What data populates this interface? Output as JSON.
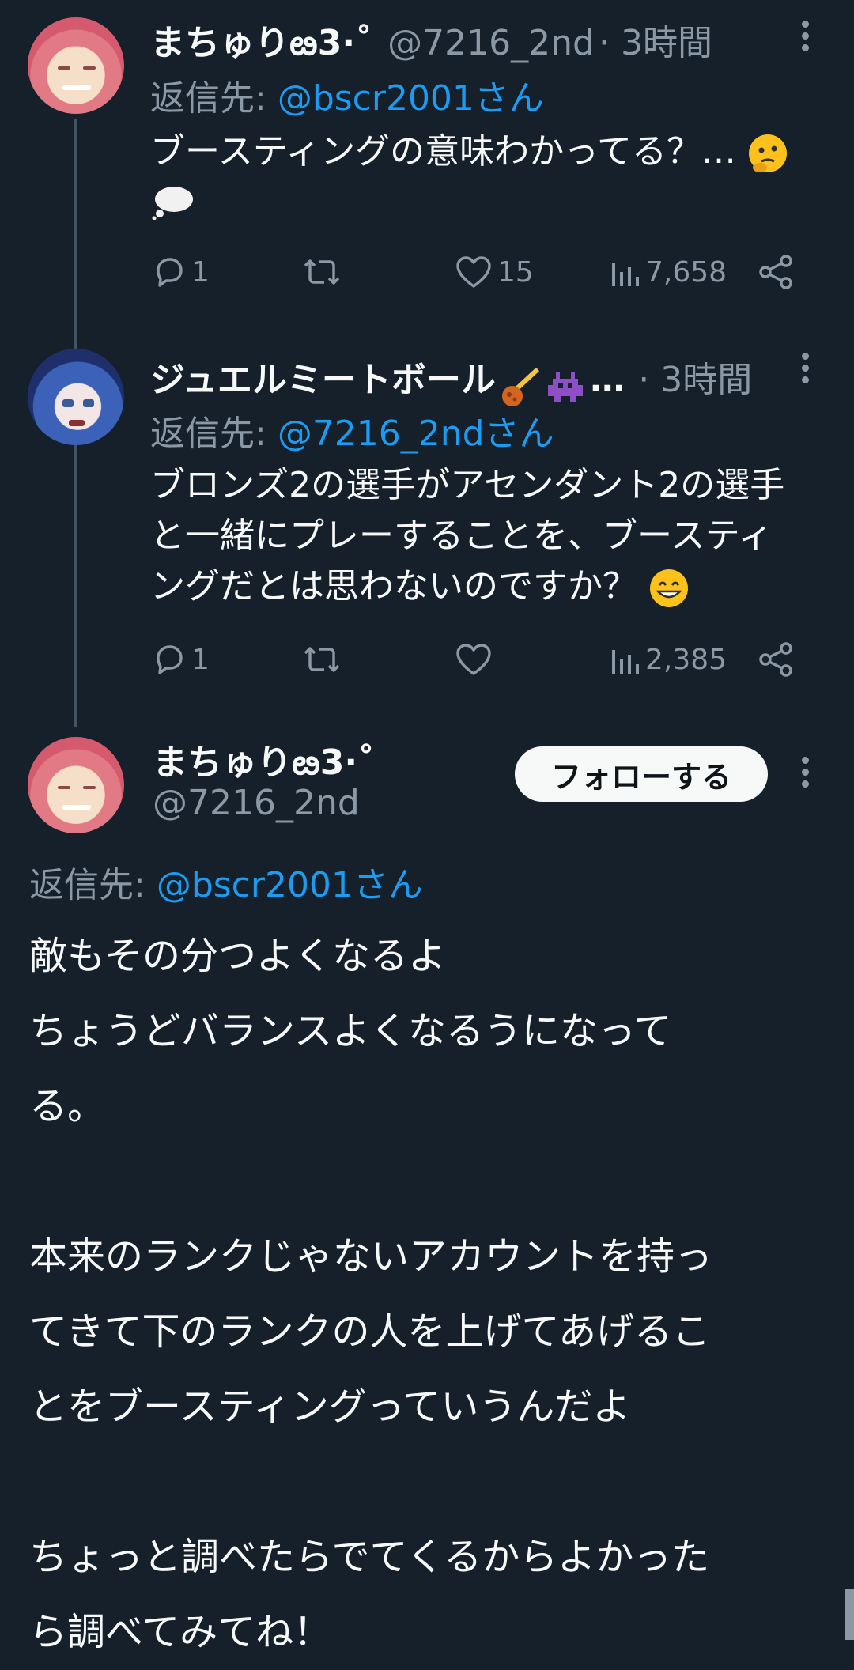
{
  "tweet1": {
    "name": "まちゅりఴ3·˚",
    "handle": "@7216_2nd",
    "time": "· 3時間",
    "reply_prefix": "返信先: ",
    "reply_mention": "@bscr2001さん",
    "text_line1": "ブースティングの意味わかってる？…",
    "reply_count": "1",
    "like_count": "15",
    "view_count": "7,658"
  },
  "tweet2": {
    "name": "ジュエルミートボール",
    "name_suffix": "…",
    "time": "· 3時間",
    "reply_prefix": "返信先: ",
    "reply_mention": "@7216_2ndさん",
    "text_lines": [
      "ブロンズ2の選手がアセンダント2の選手",
      "と一緒にプレーすることを、ブースティ",
      "ングだとは思わないのですか？"
    ],
    "reply_count": "1",
    "view_count": "2,385"
  },
  "main": {
    "name": "まちゅりఴ3·˚",
    "handle": "@7216_2nd",
    "follow_label": "フォローする",
    "reply_prefix": "返信先: ",
    "reply_mention": "@bscr2001さん",
    "lines": [
      "敵もその分つよくなるよ",
      "ちょうどバランスよくなるうになって",
      "る。",
      "",
      "本来のランクじゃないアカウントを持っ",
      "てきて下のランクの人を上げてあげるこ",
      "とをブースティングっていうんだよ",
      "",
      "ちょっと調べたらでてくるからよかった",
      "ら調べてみてね！"
    ]
  },
  "icons": [
    "reply-icon",
    "retweet-icon",
    "like-icon",
    "views-icon",
    "share-icon",
    "more-icon"
  ],
  "colors": {
    "background": "#15202b",
    "accent": "#1d9bf0",
    "secondary": "#8b98a5",
    "primary_text": "#f7f9f9"
  }
}
